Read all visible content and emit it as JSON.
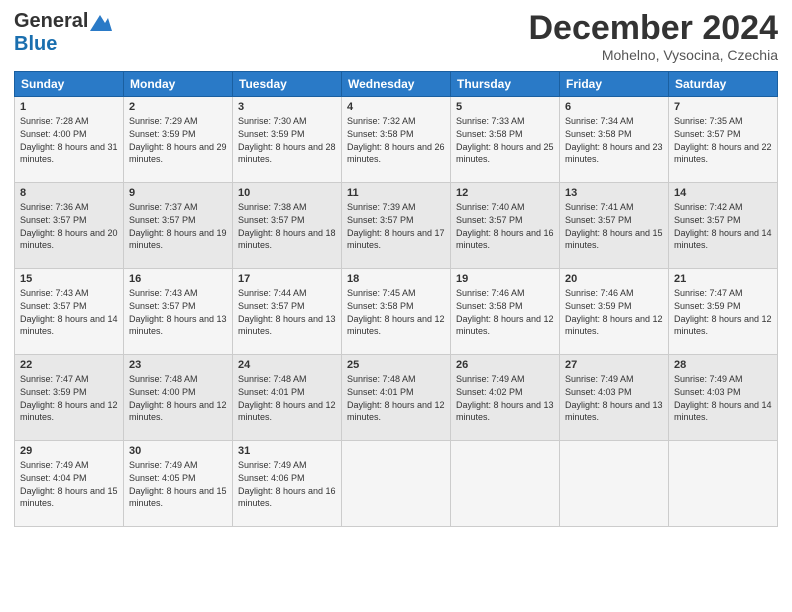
{
  "logo": {
    "general": "General",
    "blue": "Blue"
  },
  "title": "December 2024",
  "subtitle": "Mohelno, Vysocina, Czechia",
  "days_header": [
    "Sunday",
    "Monday",
    "Tuesday",
    "Wednesday",
    "Thursday",
    "Friday",
    "Saturday"
  ],
  "weeks": [
    [
      {
        "day": "1",
        "sunrise": "Sunrise: 7:28 AM",
        "sunset": "Sunset: 4:00 PM",
        "daylight": "Daylight: 8 hours and 31 minutes."
      },
      {
        "day": "2",
        "sunrise": "Sunrise: 7:29 AM",
        "sunset": "Sunset: 3:59 PM",
        "daylight": "Daylight: 8 hours and 29 minutes."
      },
      {
        "day": "3",
        "sunrise": "Sunrise: 7:30 AM",
        "sunset": "Sunset: 3:59 PM",
        "daylight": "Daylight: 8 hours and 28 minutes."
      },
      {
        "day": "4",
        "sunrise": "Sunrise: 7:32 AM",
        "sunset": "Sunset: 3:58 PM",
        "daylight": "Daylight: 8 hours and 26 minutes."
      },
      {
        "day": "5",
        "sunrise": "Sunrise: 7:33 AM",
        "sunset": "Sunset: 3:58 PM",
        "daylight": "Daylight: 8 hours and 25 minutes."
      },
      {
        "day": "6",
        "sunrise": "Sunrise: 7:34 AM",
        "sunset": "Sunset: 3:58 PM",
        "daylight": "Daylight: 8 hours and 23 minutes."
      },
      {
        "day": "7",
        "sunrise": "Sunrise: 7:35 AM",
        "sunset": "Sunset: 3:57 PM",
        "daylight": "Daylight: 8 hours and 22 minutes."
      }
    ],
    [
      {
        "day": "8",
        "sunrise": "Sunrise: 7:36 AM",
        "sunset": "Sunset: 3:57 PM",
        "daylight": "Daylight: 8 hours and 20 minutes."
      },
      {
        "day": "9",
        "sunrise": "Sunrise: 7:37 AM",
        "sunset": "Sunset: 3:57 PM",
        "daylight": "Daylight: 8 hours and 19 minutes."
      },
      {
        "day": "10",
        "sunrise": "Sunrise: 7:38 AM",
        "sunset": "Sunset: 3:57 PM",
        "daylight": "Daylight: 8 hours and 18 minutes."
      },
      {
        "day": "11",
        "sunrise": "Sunrise: 7:39 AM",
        "sunset": "Sunset: 3:57 PM",
        "daylight": "Daylight: 8 hours and 17 minutes."
      },
      {
        "day": "12",
        "sunrise": "Sunrise: 7:40 AM",
        "sunset": "Sunset: 3:57 PM",
        "daylight": "Daylight: 8 hours and 16 minutes."
      },
      {
        "day": "13",
        "sunrise": "Sunrise: 7:41 AM",
        "sunset": "Sunset: 3:57 PM",
        "daylight": "Daylight: 8 hours and 15 minutes."
      },
      {
        "day": "14",
        "sunrise": "Sunrise: 7:42 AM",
        "sunset": "Sunset: 3:57 PM",
        "daylight": "Daylight: 8 hours and 14 minutes."
      }
    ],
    [
      {
        "day": "15",
        "sunrise": "Sunrise: 7:43 AM",
        "sunset": "Sunset: 3:57 PM",
        "daylight": "Daylight: 8 hours and 14 minutes."
      },
      {
        "day": "16",
        "sunrise": "Sunrise: 7:43 AM",
        "sunset": "Sunset: 3:57 PM",
        "daylight": "Daylight: 8 hours and 13 minutes."
      },
      {
        "day": "17",
        "sunrise": "Sunrise: 7:44 AM",
        "sunset": "Sunset: 3:57 PM",
        "daylight": "Daylight: 8 hours and 13 minutes."
      },
      {
        "day": "18",
        "sunrise": "Sunrise: 7:45 AM",
        "sunset": "Sunset: 3:58 PM",
        "daylight": "Daylight: 8 hours and 12 minutes."
      },
      {
        "day": "19",
        "sunrise": "Sunrise: 7:46 AM",
        "sunset": "Sunset: 3:58 PM",
        "daylight": "Daylight: 8 hours and 12 minutes."
      },
      {
        "day": "20",
        "sunrise": "Sunrise: 7:46 AM",
        "sunset": "Sunset: 3:59 PM",
        "daylight": "Daylight: 8 hours and 12 minutes."
      },
      {
        "day": "21",
        "sunrise": "Sunrise: 7:47 AM",
        "sunset": "Sunset: 3:59 PM",
        "daylight": "Daylight: 8 hours and 12 minutes."
      }
    ],
    [
      {
        "day": "22",
        "sunrise": "Sunrise: 7:47 AM",
        "sunset": "Sunset: 3:59 PM",
        "daylight": "Daylight: 8 hours and 12 minutes."
      },
      {
        "day": "23",
        "sunrise": "Sunrise: 7:48 AM",
        "sunset": "Sunset: 4:00 PM",
        "daylight": "Daylight: 8 hours and 12 minutes."
      },
      {
        "day": "24",
        "sunrise": "Sunrise: 7:48 AM",
        "sunset": "Sunset: 4:01 PM",
        "daylight": "Daylight: 8 hours and 12 minutes."
      },
      {
        "day": "25",
        "sunrise": "Sunrise: 7:48 AM",
        "sunset": "Sunset: 4:01 PM",
        "daylight": "Daylight: 8 hours and 12 minutes."
      },
      {
        "day": "26",
        "sunrise": "Sunrise: 7:49 AM",
        "sunset": "Sunset: 4:02 PM",
        "daylight": "Daylight: 8 hours and 13 minutes."
      },
      {
        "day": "27",
        "sunrise": "Sunrise: 7:49 AM",
        "sunset": "Sunset: 4:03 PM",
        "daylight": "Daylight: 8 hours and 13 minutes."
      },
      {
        "day": "28",
        "sunrise": "Sunrise: 7:49 AM",
        "sunset": "Sunset: 4:03 PM",
        "daylight": "Daylight: 8 hours and 14 minutes."
      }
    ],
    [
      {
        "day": "29",
        "sunrise": "Sunrise: 7:49 AM",
        "sunset": "Sunset: 4:04 PM",
        "daylight": "Daylight: 8 hours and 15 minutes."
      },
      {
        "day": "30",
        "sunrise": "Sunrise: 7:49 AM",
        "sunset": "Sunset: 4:05 PM",
        "daylight": "Daylight: 8 hours and 15 minutes."
      },
      {
        "day": "31",
        "sunrise": "Sunrise: 7:49 AM",
        "sunset": "Sunset: 4:06 PM",
        "daylight": "Daylight: 8 hours and 16 minutes."
      },
      null,
      null,
      null,
      null
    ]
  ]
}
